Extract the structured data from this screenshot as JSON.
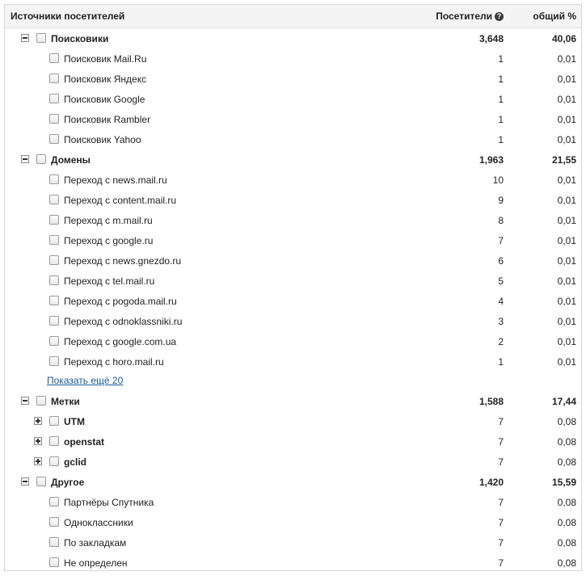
{
  "header": {
    "source": "Источники посетителей",
    "visitors": "Посетители",
    "help_glyph": "?",
    "percent": "общий %"
  },
  "groups": {
    "search": {
      "label": "Поисковики",
      "visitors": "3,648",
      "percent": "40,06",
      "items": [
        {
          "label": "Поисковик Mail.Ru",
          "visitors": "1",
          "percent": "0,01"
        },
        {
          "label": "Поисковик Яндекс",
          "visitors": "1",
          "percent": "0,01"
        },
        {
          "label": "Поисковик Google",
          "visitors": "1",
          "percent": "0,01"
        },
        {
          "label": "Поисковик Rambler",
          "visitors": "1",
          "percent": "0,01"
        },
        {
          "label": "Поисковик Yahoo",
          "visitors": "1",
          "percent": "0,01"
        }
      ]
    },
    "domains": {
      "label": "Домены",
      "visitors": "1,963",
      "percent": "21,55",
      "items": [
        {
          "label": "Переход с news.mail.ru",
          "visitors": "10",
          "percent": "0,01"
        },
        {
          "label": "Переход с content.mail.ru",
          "visitors": "9",
          "percent": "0,01"
        },
        {
          "label": "Переход с m.mail.ru",
          "visitors": "8",
          "percent": "0,01"
        },
        {
          "label": "Переход с google.ru",
          "visitors": "7",
          "percent": "0,01"
        },
        {
          "label": "Переход с news.gnezdo.ru",
          "visitors": "6",
          "percent": "0,01"
        },
        {
          "label": "Переход с tel.mail.ru",
          "visitors": "5",
          "percent": "0,01"
        },
        {
          "label": "Переход с pogoda.mail.ru",
          "visitors": "4",
          "percent": "0,01"
        },
        {
          "label": "Переход с odnoklassniki.ru",
          "visitors": "3",
          "percent": "0,01"
        },
        {
          "label": "Переход с google.com.ua",
          "visitors": "2",
          "percent": "0,01"
        },
        {
          "label": "Переход с horo.mail.ru",
          "visitors": "1",
          "percent": "0,01"
        }
      ],
      "show_more": "Показать ещё 20"
    },
    "tags": {
      "label": "Метки",
      "visitors": "1,588",
      "percent": "17,44",
      "items": [
        {
          "label": "UTM",
          "visitors": "7",
          "percent": "0,08"
        },
        {
          "label": "openstat",
          "visitors": "7",
          "percent": "0,08"
        },
        {
          "label": "gclid",
          "visitors": "7",
          "percent": "0,08"
        }
      ]
    },
    "other": {
      "label": "Другое",
      "visitors": "1,420",
      "percent": "15,59",
      "items": [
        {
          "label": "Партнёры Спутника",
          "visitors": "7",
          "percent": "0,08"
        },
        {
          "label": "Одноклассники",
          "visitors": "7",
          "percent": "0,08"
        },
        {
          "label": "По закладкам",
          "visitors": "7",
          "percent": "0,08"
        },
        {
          "label": "Не определен",
          "visitors": "7",
          "percent": "0,08"
        }
      ]
    }
  }
}
